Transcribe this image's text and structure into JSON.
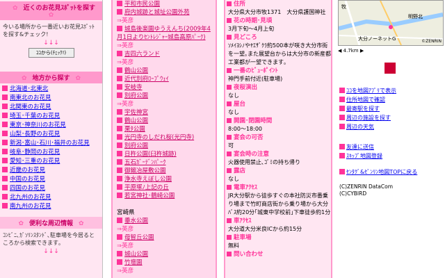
{
  "col1": {
    "section1_title": "近くのお花見ｽﾎﾟｯﾄを探す",
    "section1_text": "今いる場所から一番近いお花見ｽﾎﾟｯﾄを探す&チェック!",
    "button_label": "ｺｺから(ﾁｪｯｸ!)",
    "arrows": "↓↓↓",
    "section2_title": "地方から探す",
    "regions": [
      "北海道･北東北",
      "南東北のお花見",
      "北関東のお花見",
      "埼玉･千葉のお花見",
      "東京･神奈川のお花見",
      "山梨･長野のお花見",
      "新潟･富山･石川･福井のお花見",
      "岐阜･静岡のお花見",
      "愛知･三重のお花見",
      "近畿のお花見",
      "中国のお花見",
      "四国のお花見",
      "北九州のお花見",
      "南九州のお花見"
    ],
    "section3_title": "便利な周辺情報",
    "section3_text": "ｺﾝﾋﾞﾆ､ｶﾞｿﾘﾝｽﾀﾝﾄﾞ､駐車場を今居るところから検索できます｡"
  },
  "col3": {
    "items": [
      {
        "text": "平和市民公園",
        "type": "link"
      },
      {
        "text": "府内城跡と城址公園外苑",
        "type": "link"
      },
      {
        "text": "⇒英彦",
        "type": "sub"
      },
      {
        "text": "城島後楽園ゆうえんち(2009年4月1日よりｾﾝﾄﾚｼﾞｬｰ城島高原ﾊﾟｰｸ)",
        "type": "link2"
      },
      {
        "text": "⇒英彦",
        "type": "sub"
      },
      {
        "text": "吉四六ランド",
        "type": "link"
      },
      {
        "text": "⇒英彦",
        "type": "sub"
      },
      {
        "text": "鶴山公園",
        "type": "link"
      },
      {
        "text": "近代別府ﾛｰﾌﾟｳｪｲ",
        "type": "link"
      },
      {
        "text": "安岐寺",
        "type": "link"
      },
      {
        "text": "別府公園",
        "type": "link"
      },
      {
        "text": "⇒英彦",
        "type": "sub"
      },
      {
        "text": "宇佐神宮",
        "type": "link"
      },
      {
        "text": "鶴山公園",
        "type": "link"
      },
      {
        "text": "栗ﾀ公園",
        "type": "link"
      },
      {
        "text": "光円寺のしだれ桜(光円寺)",
        "type": "link"
      },
      {
        "text": "別府公園",
        "type": "link"
      },
      {
        "text": "日杵公園(臼杵城跡)",
        "type": "link"
      },
      {
        "text": "五石ｶﾞｰﾃﾞﾝﾊﾟｰｸ",
        "type": "link"
      },
      {
        "text": "御鍛冶屋敷公園",
        "type": "link"
      },
      {
        "text": "浄水寺えぼし公園",
        "type": "link"
      },
      {
        "text": "平原塚ﾉ上記の丘",
        "type": "link"
      },
      {
        "text": "若宮神社･鶴崎公園",
        "type": "link"
      },
      {
        "text": "",
        "type": "plain"
      },
      {
        "text": "宮崎県",
        "type": "plain"
      },
      {
        "text": "垂水公園",
        "type": "link"
      },
      {
        "text": "⇒英彦",
        "type": "sub"
      },
      {
        "text": "母智丘公園",
        "type": "link"
      },
      {
        "text": "⇒英彦",
        "type": "sub"
      },
      {
        "text": "城山公園",
        "type": "link"
      },
      {
        "text": "竹壇園",
        "type": "link"
      },
      {
        "text": "⇒英彦",
        "type": "sub"
      }
    ]
  },
  "col5": {
    "entries": [
      {
        "label": "住所",
        "value": "大分県大分市牧1371　大分県護国神社"
      },
      {
        "label": "花の時期･見頃",
        "value": "3月下旬～4月上旬"
      },
      {
        "label": "見どころ",
        "value": "ｿﾒｲﾖｼﾉやﾔｴｻﾞｸﾗ約500本が咲き大分市街を一望｡また展望台からは大分市の新産都工業都が一望できます｡"
      },
      {
        "label": "一番のﾋﾞｭｰﾎﾟｲﾝﾄ",
        "value": "神門手前付近(駐車場)"
      },
      {
        "label": "夜桜演出",
        "value": "なし"
      },
      {
        "label": "屋台",
        "value": "なし"
      },
      {
        "label": "開園･閉園時間",
        "value": "8:00～18:00"
      },
      {
        "label": "宴会の可否",
        "value": "可"
      },
      {
        "label": "宴会時の注意",
        "value": "火器使用禁止､ｺﾞﾐの持ち帰り"
      },
      {
        "label": "露店",
        "value": "なし"
      },
      {
        "label": "電車ｱｸｾｽ",
        "value": "JR大分駅から徒歩すぐの本社防災市番乗り場まで竹町商店街から乗り場から大分ﾊﾞｽ約20分｢城東中学校前｣下車徒歩約1分"
      },
      {
        "label": "車ｱｸｾｽ",
        "value": "大分道大分米良ICから約15分"
      },
      {
        "label": "駐車場",
        "value": "無料"
      },
      {
        "label": "問い合わせ",
        "value": ""
      }
    ]
  },
  "col6": {
    "map_labels": [
      "牧",
      "明野北",
      "大分ノーネットG",
      "©ZENRIN"
    ],
    "scale": "4.7km",
    "links": [
      "ｺｺを地図ｱﾌﾟﾘで表示",
      "住所地図で確認",
      "最寄駅を探す",
      "周辺の施設を探す",
      "周辺の天気"
    ],
    "links2": [
      "友達に送信",
      "ｽｷｯﾌﾟ地図登録"
    ],
    "top_link": "ｾﾝﾀｸﾞ&ｾﾞﾝﾘﾝ地図TOPに戻る",
    "copy1": "(C)ZENRIN DataCom",
    "copy2": "(C)CYBIRD"
  },
  "colors": {
    "accent": "#ff3399",
    "header_bg": "#ff99cc",
    "panel_bg": "#ffe6f2",
    "link": "#0000ee"
  }
}
